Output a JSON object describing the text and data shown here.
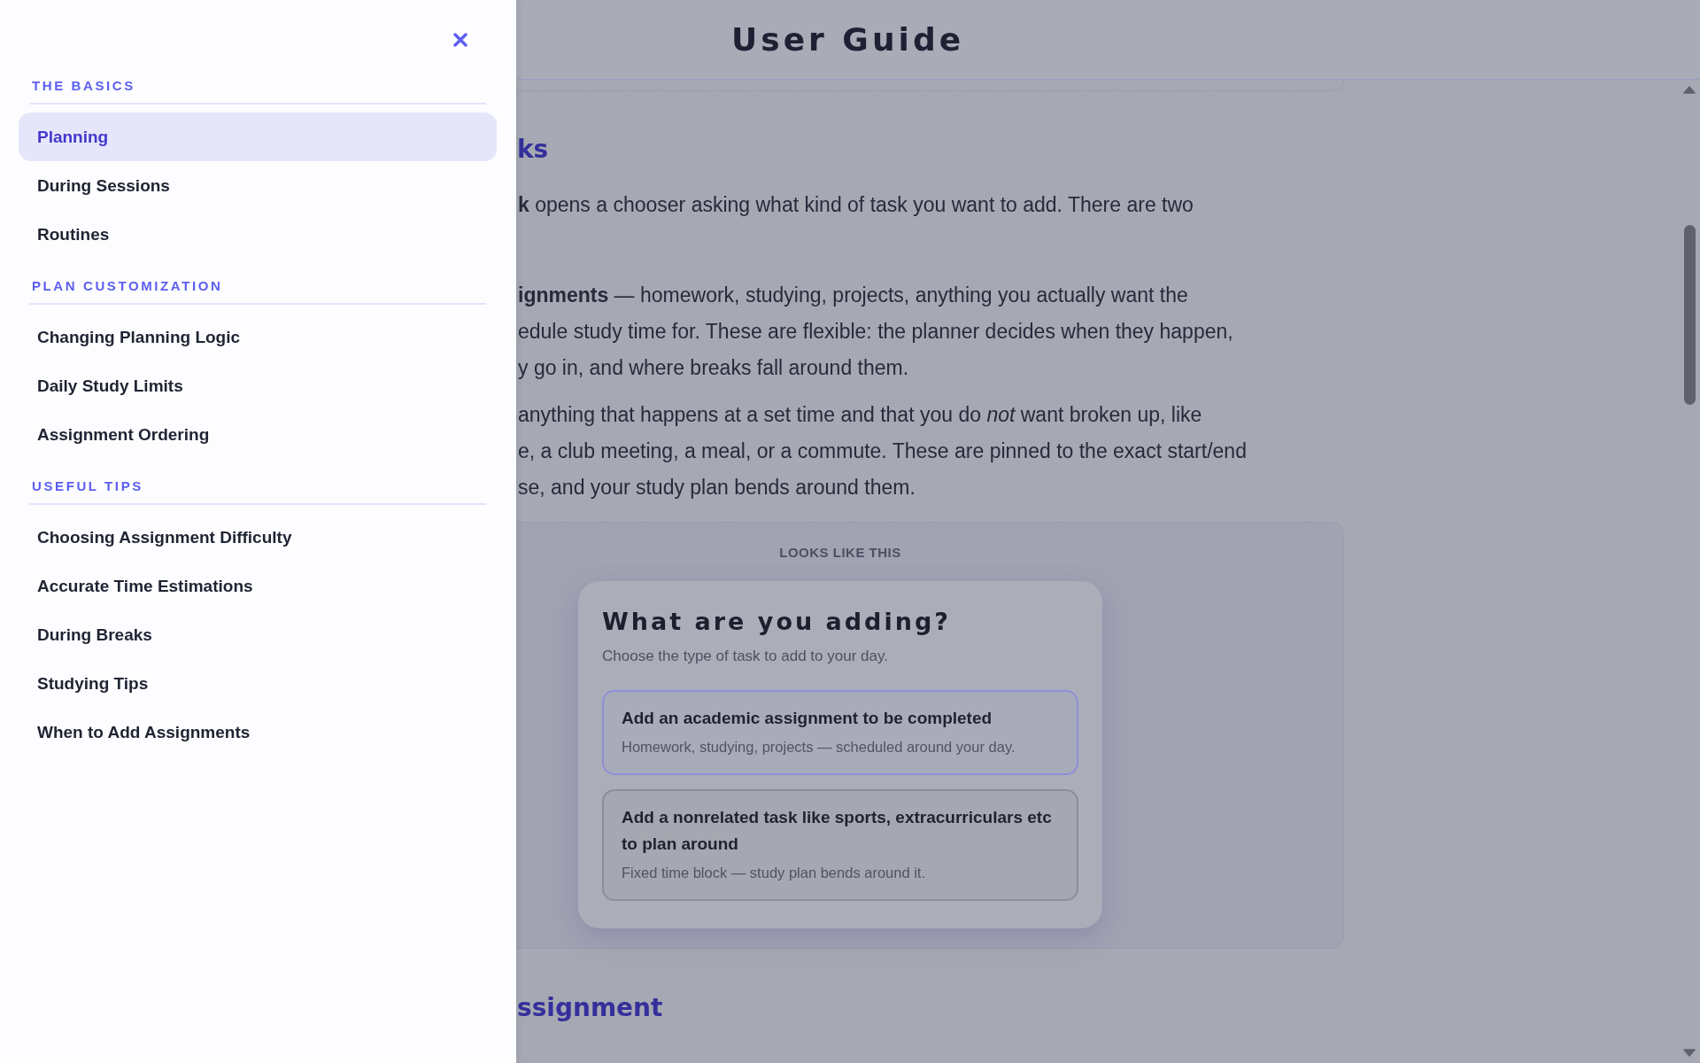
{
  "sidebar": {
    "sections": [
      {
        "title": "THE BASICS",
        "items": [
          {
            "label": "Planning",
            "selected": true
          },
          {
            "label": "During Sessions",
            "selected": false
          },
          {
            "label": "Routines",
            "selected": false
          }
        ]
      },
      {
        "title": "PLAN CUSTOMIZATION",
        "items": [
          {
            "label": "Changing Planning Logic",
            "selected": false
          },
          {
            "label": "Daily Study Limits",
            "selected": false
          },
          {
            "label": "Assignment Ordering",
            "selected": false
          }
        ]
      },
      {
        "title": "USEFUL TIPS",
        "items": [
          {
            "label": "Choosing Assignment Difficulty",
            "selected": false
          },
          {
            "label": "Accurate Time Estimations",
            "selected": false
          },
          {
            "label": "During Breaks",
            "selected": false
          },
          {
            "label": "Studying Tips",
            "selected": false
          },
          {
            "label": "When to Add Assignments",
            "selected": false
          }
        ]
      }
    ]
  },
  "header": {
    "title": "User Guide"
  },
  "content": {
    "heading": "ks",
    "intro": {
      "lines": [
        "**k** opens a chooser asking what kind of task you want to add. There are two"
      ]
    },
    "list": [
      {
        "lines": [
          "**ignments** — homework, studying, projects, anything you actually want the",
          "edule study time for. These are flexible: the planner decides when they happen,",
          "y go in, and where breaks fall around them."
        ]
      },
      {
        "lines": [
          "anything that happens at a set time and that you do *not* want broken up, like",
          "e, a club meeting, a meal, or a commute. These are pinned to the exact start/end",
          "se, and your study plan bends around them."
        ]
      }
    ],
    "example": {
      "label": "LOOKS LIKE THIS",
      "dialog": {
        "title": "What are you adding?",
        "subtitle": "Choose the type of task to add to your day.",
        "options": [
          {
            "title": "Add an academic assignment to be completed",
            "description": "Homework, studying, projects — scheduled around your day.",
            "selected": true
          },
          {
            "title": "Add a nonrelated task like sports, extracurriculars etc to plan around",
            "description": "Fixed time block — study plan bends around it.",
            "selected": false
          }
        ]
      }
    },
    "next_heading": "ssignment"
  }
}
